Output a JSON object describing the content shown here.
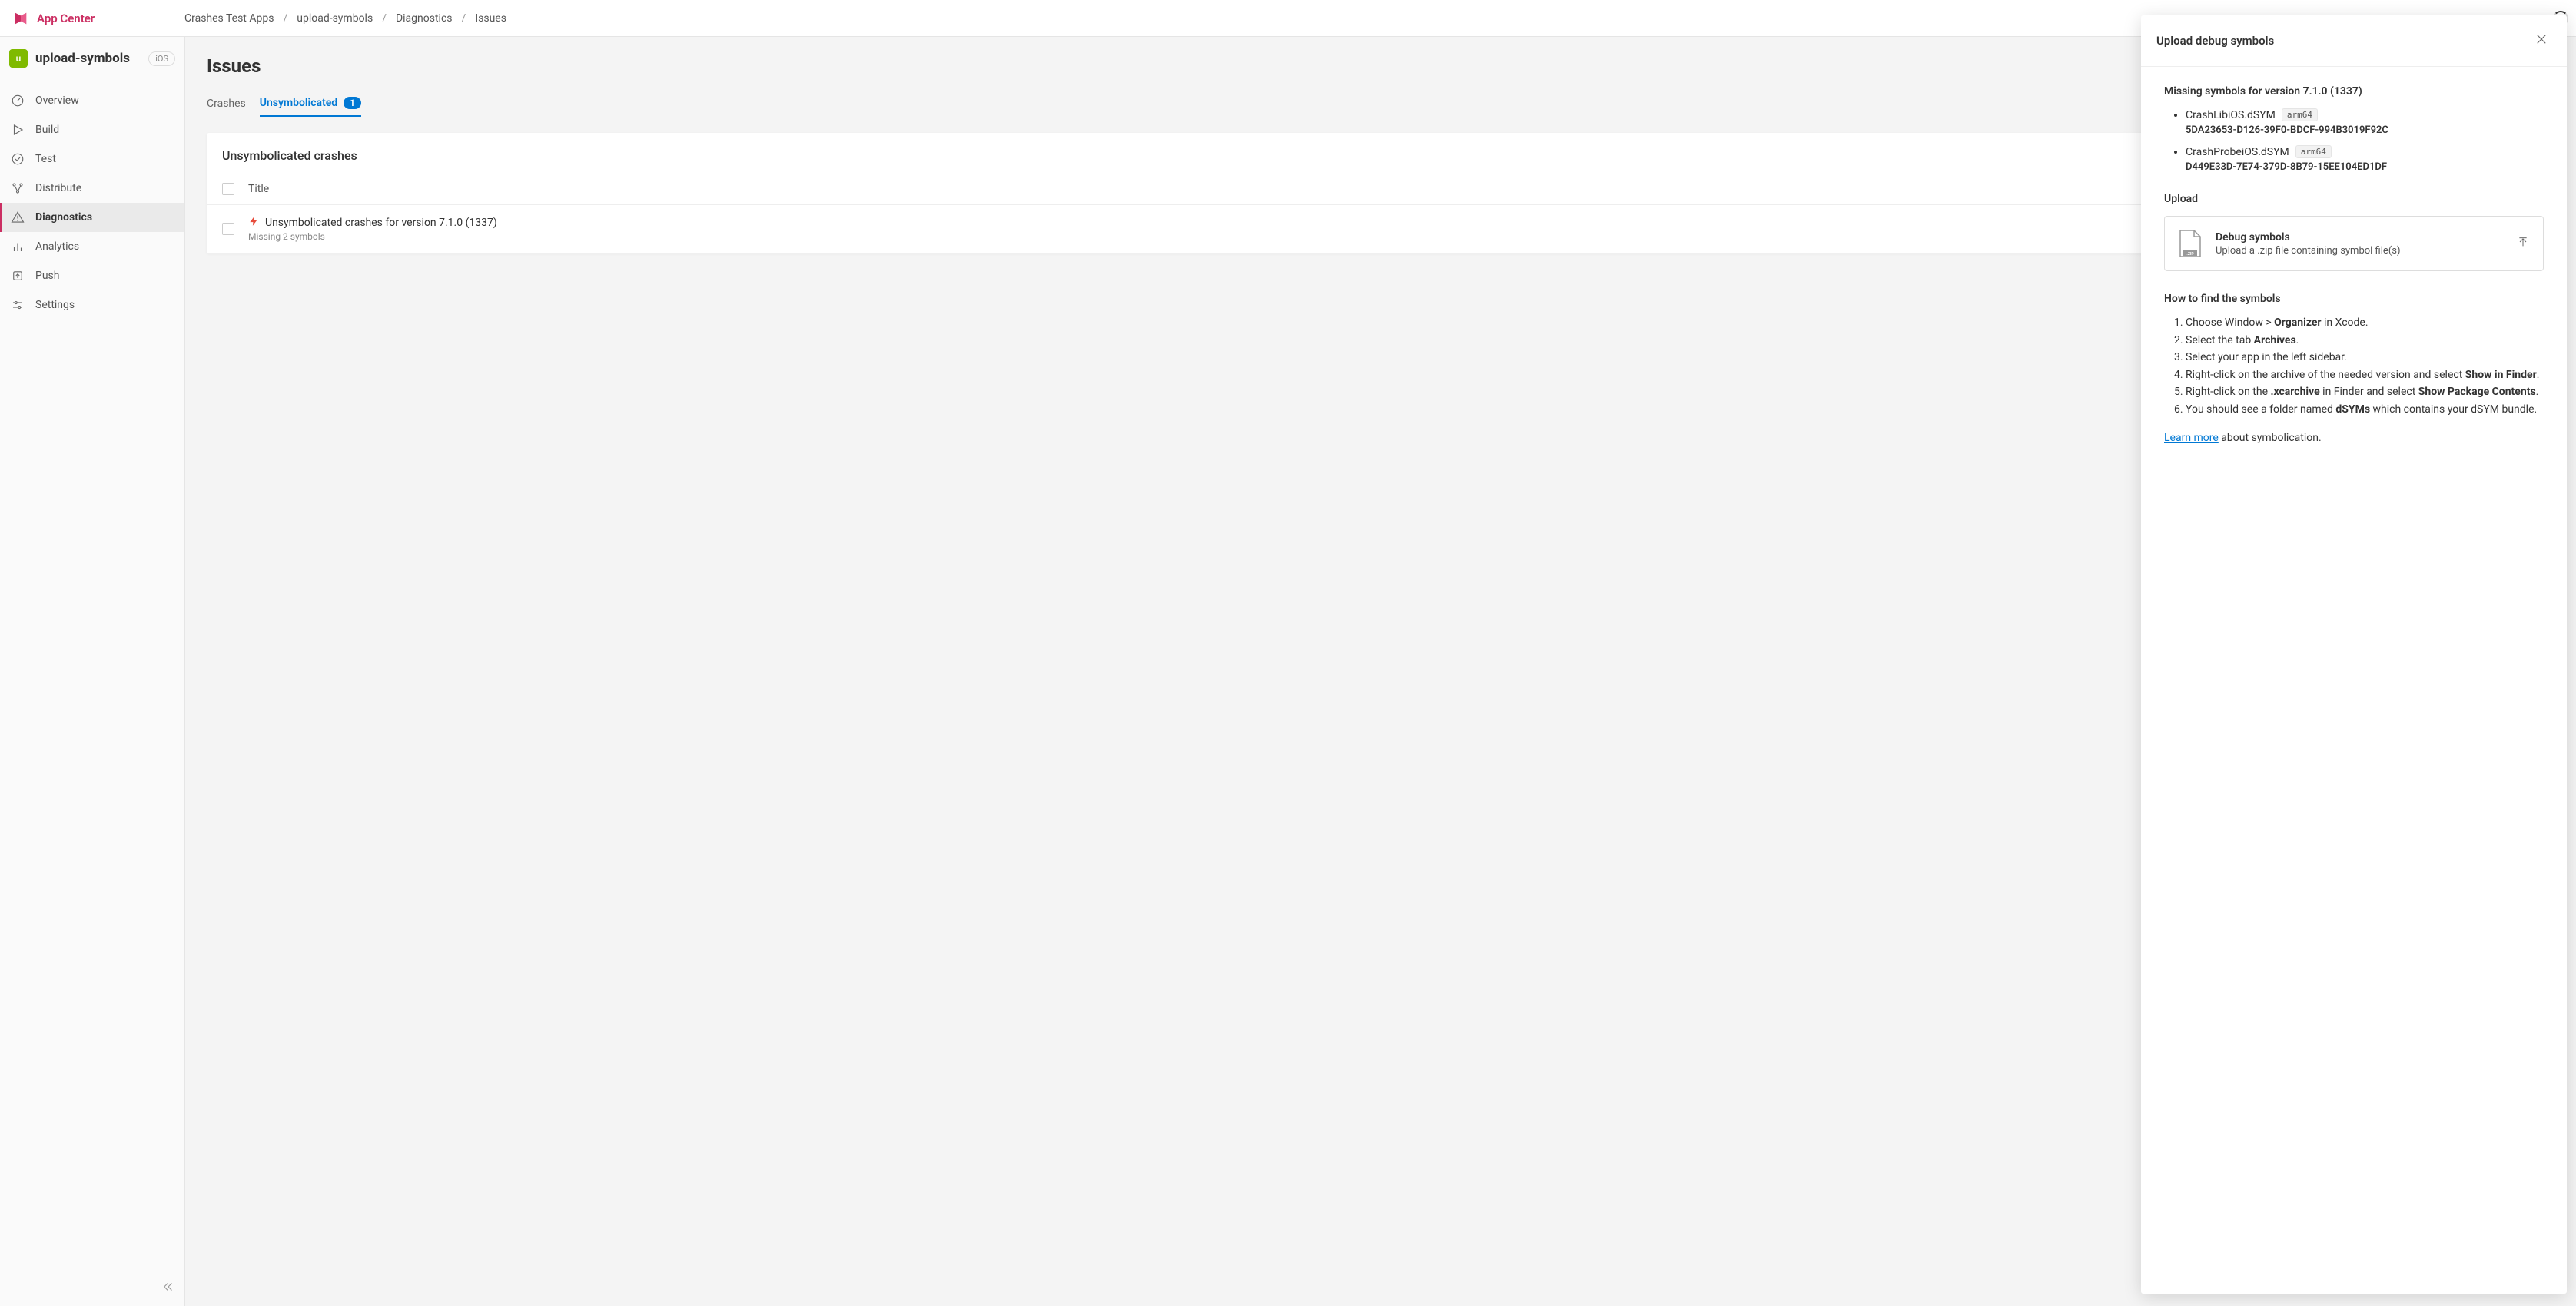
{
  "brand": "App Center",
  "breadcrumb": {
    "items": [
      "Crashes Test Apps",
      "upload-symbols",
      "Diagnostics",
      "Issues"
    ]
  },
  "sidebar": {
    "app_avatar_letter": "u",
    "app_name": "upload-symbols",
    "platform": "iOS",
    "nav": [
      {
        "label": "Overview"
      },
      {
        "label": "Build"
      },
      {
        "label": "Test"
      },
      {
        "label": "Distribute"
      },
      {
        "label": "Diagnostics"
      },
      {
        "label": "Analytics"
      },
      {
        "label": "Push"
      },
      {
        "label": "Settings"
      }
    ]
  },
  "page": {
    "title": "Issues",
    "tabs": {
      "crashes": "Crashes",
      "unsymbolicated": "Unsymbolicated",
      "badge": "1"
    },
    "panel_header": "Unsymbolicated crashes",
    "table": {
      "col_title": "Title"
    },
    "rows": [
      {
        "title": "Unsymbolicated crashes for version 7.1.0 (1337)",
        "subtitle": "Missing 2 symbols"
      }
    ]
  },
  "side_panel": {
    "title": "Upload debug symbols",
    "missing_heading": "Missing symbols for version 7.1.0 (1337)",
    "symbols": [
      {
        "name": "CrashLibiOS.dSYM",
        "arch": "arm64",
        "uuid": "5DA23653-D126-39F0-BDCF-994B3019F92C"
      },
      {
        "name": "CrashProbeiOS.dSYM",
        "arch": "arm64",
        "uuid": "D449E33D-7E74-379D-8B79-15EE104ED1DF"
      }
    ],
    "upload_heading": "Upload",
    "upload_box": {
      "title": "Debug symbols",
      "subtitle": "Upload a .zip file containing symbol file(s)",
      "zip_label": ".ZIP"
    },
    "howto_heading": "How to find the symbols",
    "howto": {
      "step1_a": "Choose Window > ",
      "step1_b": "Organizer",
      "step1_c": " in Xcode.",
      "step2_a": "Select the tab ",
      "step2_b": "Archives",
      "step2_c": ".",
      "step3": "Select your app in the left sidebar.",
      "step4_a": "Right-click on the archive of the needed version and select ",
      "step4_b": "Show in Finder",
      "step4_c": ".",
      "step5_a": "Right-click on the ",
      "step5_b": ".xcarchive",
      "step5_c": " in Finder and select ",
      "step5_d": "Show Package Contents",
      "step5_e": ".",
      "step6_a": "You should see a folder named ",
      "step6_b": "dSYMs",
      "step6_c": " which contains your dSYM bundle."
    },
    "learn_more_link": "Learn more",
    "learn_more_suffix": " about symbolication."
  }
}
